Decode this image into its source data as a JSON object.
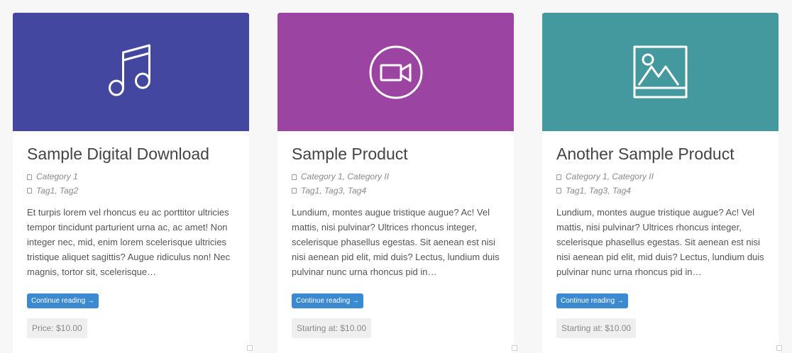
{
  "cards": [
    {
      "icon": "music-note-icon",
      "accent": "#43479f",
      "title": "Sample Digital Download",
      "categories": "Category 1",
      "tags": "Tag1, Tag2",
      "excerpt": "Et turpis lorem vel rhoncus eu ac porttitor ultricies tempor tincidunt parturient urna ac, ac amet! Non integer nec, mid, enim lorem scelerisque ultricies tristique aliquet sagittis? Augue ridiculus non! Nec magnis, tortor sit, scelerisque…",
      "read_more": "Continue reading →",
      "price": "Price: $10.00"
    },
    {
      "icon": "video-camera-icon",
      "accent": "#9c44a1",
      "title": "Sample Product",
      "categories": "Category 1, Category II",
      "tags": "Tag1, Tag3, Tag4",
      "excerpt": "Lundium, montes augue tristique augue? Ac! Vel mattis, nisi pulvinar? Ultrices rhoncus integer, scelerisque phasellus egestas. Sit aenean est nisi nisi aenean pid elit, mid duis? Lectus, lundium duis pulvinar nunc urna rhoncus pid in…",
      "read_more": "Continue reading →",
      "price": "Starting at: $10.00"
    },
    {
      "icon": "image-icon",
      "accent": "#44999f",
      "title": "Another Sample Product",
      "categories": "Category 1, Category II",
      "tags": "Tag1, Tag3, Tag4",
      "excerpt": "Lundium, montes augue tristique augue? Ac! Vel mattis, nisi pulvinar? Ultrices rhoncus integer, scelerisque phasellus egestas. Sit aenean est nisi nisi aenean pid elit, mid duis? Lectus, lundium duis pulvinar nunc urna rhoncus pid in…",
      "read_more": "Continue reading →",
      "price": "Starting at: $10.00"
    }
  ]
}
